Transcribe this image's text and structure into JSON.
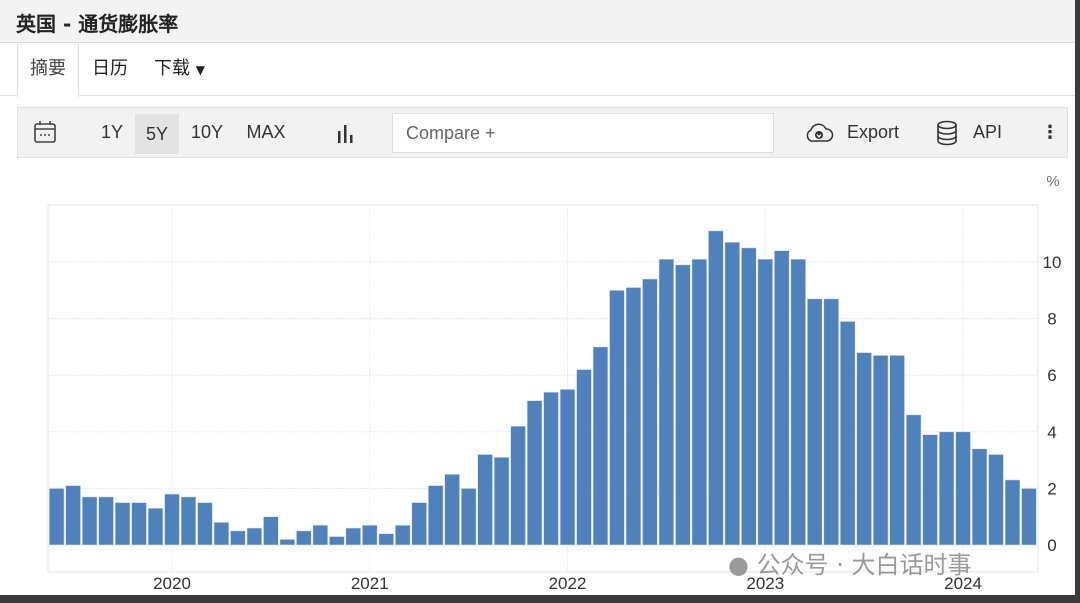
{
  "title": "英国 - 通货膨胀率",
  "tabs": [
    {
      "label": "摘要",
      "active": true
    },
    {
      "label": "日历"
    },
    {
      "label": "下载"
    }
  ],
  "toolbar": {
    "ranges": [
      "1Y",
      "5Y",
      "10Y",
      "MAX"
    ],
    "selected_range": "5Y",
    "compare_placeholder": "Compare +",
    "export_label": "Export",
    "api_label": "API"
  },
  "watermark": "公众号 · 大白话时事",
  "colors": {
    "bar": "#4f81bd",
    "selected_range_bg": "#e3e3e3"
  },
  "chart_data": {
    "type": "bar",
    "unit": "%",
    "start": "2019-06",
    "frequency": "monthly",
    "values": [
      2.0,
      2.1,
      1.7,
      1.7,
      1.5,
      1.5,
      1.3,
      1.8,
      1.7,
      1.5,
      0.8,
      0.5,
      0.6,
      1.0,
      0.2,
      0.5,
      0.7,
      0.3,
      0.6,
      0.7,
      0.4,
      0.7,
      1.5,
      2.1,
      2.5,
      2.0,
      3.2,
      3.1,
      4.2,
      5.1,
      5.4,
      5.5,
      6.2,
      7.0,
      9.0,
      9.1,
      9.4,
      10.1,
      9.9,
      10.1,
      11.1,
      10.7,
      10.5,
      10.1,
      10.4,
      10.1,
      8.7,
      8.7,
      7.9,
      6.8,
      6.7,
      6.7,
      4.6,
      3.9,
      4.0,
      4.0,
      3.4,
      3.2,
      2.3,
      2.0
    ],
    "x_tick_labels": [
      "2020",
      "2021",
      "2022",
      "2023",
      "2024"
    ],
    "y_ticks": [
      "0",
      "2",
      "4",
      "6",
      "8",
      "10"
    ],
    "ylim": [
      0,
      12
    ],
    "grid": true
  }
}
